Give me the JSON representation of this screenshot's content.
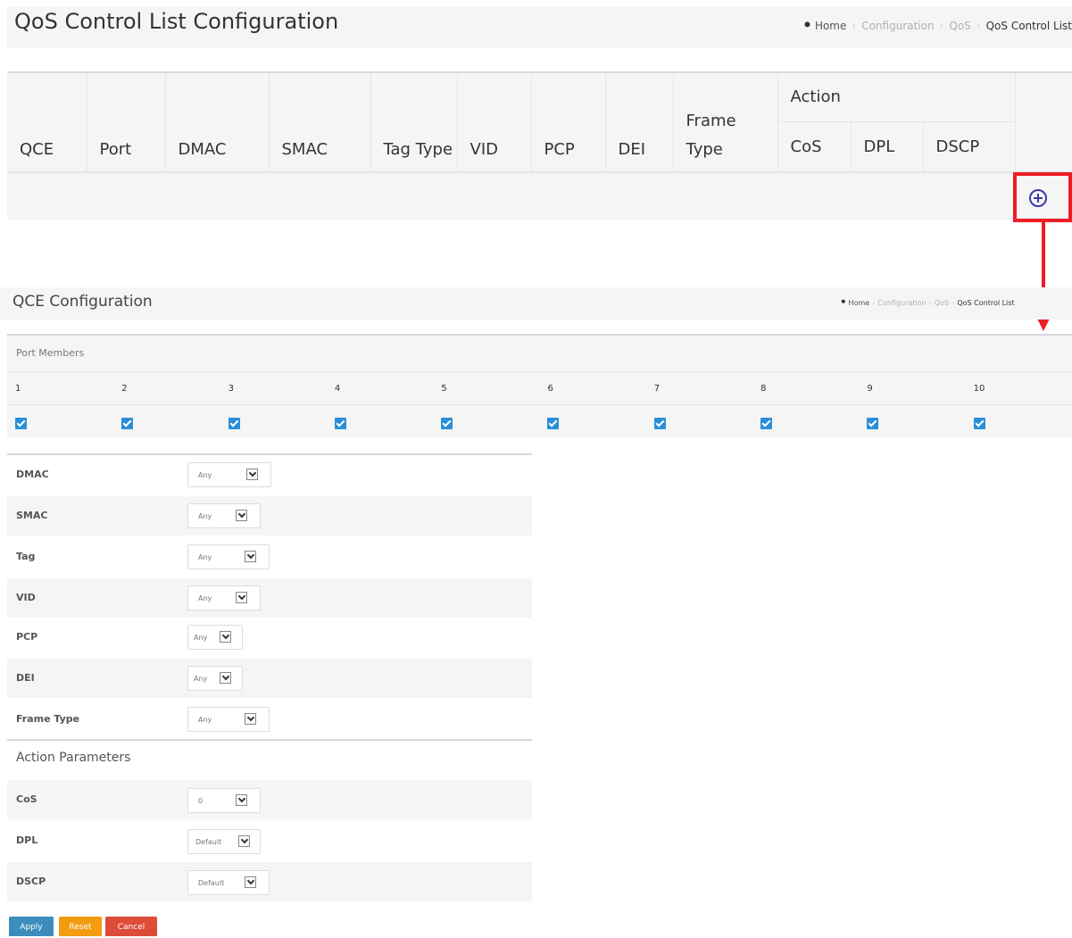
{
  "top": {
    "title": "QoS Control List Configuration",
    "breadcrumb": {
      "home": "Home",
      "items": [
        "Configuration",
        "QoS"
      ],
      "current": "QoS Control List"
    },
    "table": {
      "headers": [
        "QCE",
        "Port",
        "DMAC",
        "SMAC",
        "Tag Type",
        "VID",
        "PCP",
        "DEI",
        "Frame Type"
      ],
      "action_group": "Action",
      "action_headers": [
        "CoS",
        "DPL",
        "DSCP"
      ]
    }
  },
  "qce": {
    "title": "QCE Configuration",
    "breadcrumb": {
      "home": "Home",
      "items": [
        "Configuration",
        "QoS"
      ],
      "current": "QoS Control List"
    },
    "port_members_label": "Port Members",
    "ports": [
      "1",
      "2",
      "3",
      "4",
      "5",
      "6",
      "7",
      "8",
      "9",
      "10"
    ],
    "fields": [
      {
        "label": "DMAC",
        "value": "Any"
      },
      {
        "label": "SMAC",
        "value": "Any"
      },
      {
        "label": "Tag",
        "value": "Any"
      },
      {
        "label": "VID",
        "value": "Any"
      },
      {
        "label": "PCP",
        "value": "Any"
      },
      {
        "label": "DEI",
        "value": "Any"
      },
      {
        "label": "Frame Type",
        "value": "Any"
      }
    ],
    "action_parameters_label": "Action Parameters",
    "action_fields": [
      {
        "label": "CoS",
        "value": "0"
      },
      {
        "label": "DPL",
        "value": "Default"
      },
      {
        "label": "DSCP",
        "value": "Default"
      }
    ],
    "buttons": {
      "apply": "Apply",
      "reset": "Reset",
      "cancel": "Cancel"
    }
  },
  "colors": {
    "highlight": "#ee1c25",
    "add_icon": "#3b3aa8",
    "checkbox": "#2a8fd6",
    "apply": "#3c8dbc",
    "reset": "#f39c12",
    "cancel": "#dd4b39"
  },
  "icons": [
    "home-icon",
    "add-circle-icon",
    "checkbox-checked-icon",
    "select-arrow-icon"
  ]
}
